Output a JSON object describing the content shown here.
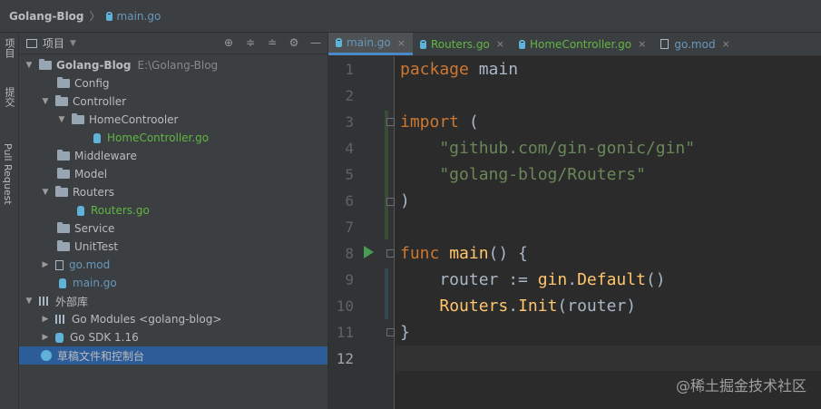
{
  "titlebar": {
    "project": "Golang-Blog",
    "separator": "〉",
    "file": "main.go"
  },
  "leftstrip": {
    "tabs": [
      "项目",
      "提交",
      "Pull Request"
    ]
  },
  "panel": {
    "title": "项目"
  },
  "tree": [
    {
      "label": "Golang-Blog",
      "path": "E:\\Golang-Blog",
      "type": "root"
    },
    {
      "label": "Config",
      "type": "folder"
    },
    {
      "label": "Controller",
      "type": "folder"
    },
    {
      "label": "HomeControoler",
      "type": "folder"
    },
    {
      "label": "HomeController.go",
      "type": "go"
    },
    {
      "label": "Middleware",
      "type": "folder"
    },
    {
      "label": "Model",
      "type": "folder"
    },
    {
      "label": "Routers",
      "type": "folder"
    },
    {
      "label": "Routers.go",
      "type": "go"
    },
    {
      "label": "Service",
      "type": "folder"
    },
    {
      "label": "UnitTest",
      "type": "folder"
    },
    {
      "label": "go.mod",
      "type": "mod"
    },
    {
      "label": "main.go",
      "type": "go"
    },
    {
      "label": "外部库",
      "type": "lib"
    },
    {
      "label": "Go Modules <golang-blog>",
      "type": "lib"
    },
    {
      "label": "Go SDK 1.16",
      "type": "sdk"
    },
    {
      "label": "草稿文件和控制台",
      "type": "scratch"
    }
  ],
  "tabs": [
    {
      "label": "main.go",
      "close": "×"
    },
    {
      "label": "Routers.go",
      "close": "×"
    },
    {
      "label": "HomeController.go",
      "close": "×"
    },
    {
      "label": "go.mod",
      "close": "×"
    }
  ],
  "editor": {
    "line_numbers": [
      "1",
      "2",
      "3",
      "4",
      "5",
      "6",
      "7",
      "8",
      "9",
      "10",
      "11",
      "12"
    ],
    "lines": {
      "l1_kw": "package",
      "l1_name": " main",
      "l3_kw": "import",
      "l3_rest": " (",
      "l4": "    \"github.com/gin-gonic/gin\"",
      "l5": "    \"golang-blog/Routers\"",
      "l6": ")",
      "l8_kw": "func",
      "l8_fn": " main",
      "l8_rest": "() {",
      "l9_a": "    router := ",
      "l9_pkg": "gin",
      "l9_dot": ".",
      "l9_fn": "Default",
      "l9_b": "()",
      "l10_a": "    ",
      "l10_pkg": "Routers",
      "l10_dot": ".",
      "l10_fn": "Init",
      "l10_b": "(router)",
      "l11": "}"
    }
  },
  "watermark": "@稀土掘金技术社区"
}
